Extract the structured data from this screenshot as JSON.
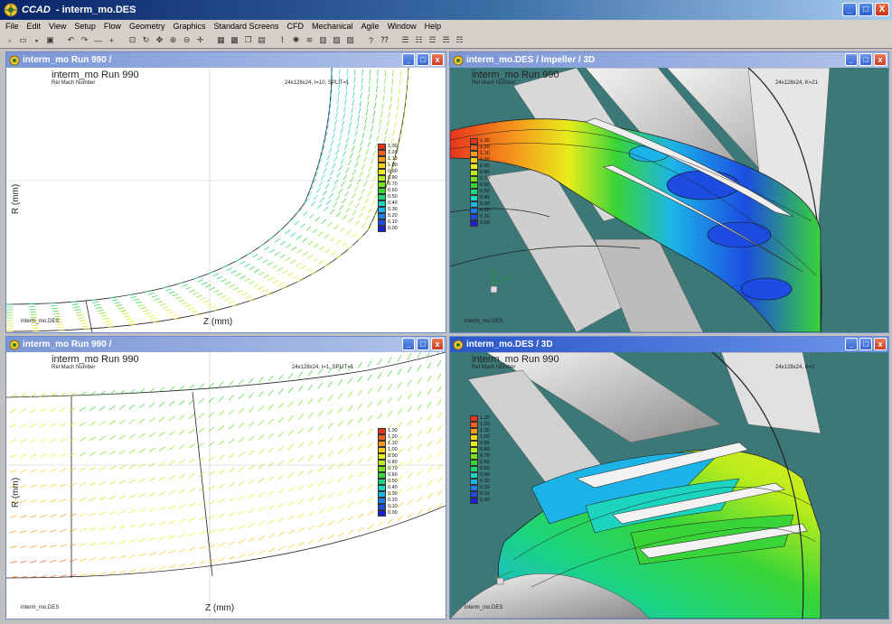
{
  "app": {
    "title_app": "CCAD",
    "title_sep": " - ",
    "title_file": "interm_mo.DES",
    "window_buttons": {
      "minimize": "_",
      "maximize": "□",
      "close": "X"
    }
  },
  "menu": [
    "File",
    "Edit",
    "View",
    "Setup",
    "Flow",
    "Geometry",
    "Graphics",
    "Standard Screens",
    "CFD",
    "Mechanical",
    "Agile",
    "Window",
    "Help"
  ],
  "toolbar_icons": [
    "new-icon",
    "open-icon",
    "save-icon",
    "print-icon",
    "undo-icon",
    "redo-icon",
    "minus-icon",
    "plus-icon",
    "zoom-box-icon",
    "rotate-icon",
    "pan-icon",
    "zoom-in-icon",
    "zoom-out-icon",
    "move-icon",
    "grid-icon",
    "mesh-icon",
    "copy-icon",
    "paste-icon",
    "blade-icon",
    "impeller-icon",
    "flow-icon",
    "stage-icon",
    "chart-icon",
    "report-icon",
    "help-icon",
    "whats-this-icon",
    "layout1-icon",
    "layout2-icon",
    "layout3-icon",
    "layout4-icon",
    "layout5-icon"
  ],
  "windows": {
    "top_left": {
      "title": "interm_mo Run 990 /",
      "run_title": "interm_mo Run 990",
      "variable": "Rel Mach Number",
      "grid_info": "24x128x24, I=10, SPLIT=1",
      "file": "interm_mo.DES",
      "xlabel": "Z (mm)",
      "ylabel": "R (mm)"
    },
    "top_right": {
      "title": "interm_mo.DES / Impeller / 3D",
      "run_title": "interm_mo Run 990",
      "variable": "Rel Mach Number",
      "grid_info": "24x128x24, K=21",
      "file": "interm_mo.DES"
    },
    "bottom_left": {
      "title": "interm_mo Run 990 /",
      "run_title": "interm_mo Run 990",
      "variable": "Rel Mach Number",
      "grid_info": "24x128x24, I=1, SPLIT=1",
      "file": "interm_mo.DES",
      "xlabel": "Z (mm)",
      "ylabel": "R (mm)"
    },
    "bottom_right": {
      "title": "interm_mo.DES / 3D",
      "run_title": "interm_mo Run 990",
      "variable": "Rel Mach Number",
      "grid_info": "24x128x24, K=1",
      "file": "interm_mo.DES"
    }
  },
  "legend": {
    "values": [
      "1.30",
      "1.20",
      "1.10",
      "1.00",
      "0.90",
      "0.80",
      "0.70",
      "0.60",
      "0.50",
      "0.40",
      "0.30",
      "0.20",
      "0.10",
      "0.00"
    ],
    "colors": [
      "#e8341c",
      "#f0601c",
      "#f49a1c",
      "#f4cc1c",
      "#e8ec1c",
      "#b8ec1c",
      "#78e01c",
      "#38d438",
      "#1cd47c",
      "#1cd4c0",
      "#1cb4e8",
      "#1c80e8",
      "#1c4ce0",
      "#1c20d0"
    ]
  }
}
